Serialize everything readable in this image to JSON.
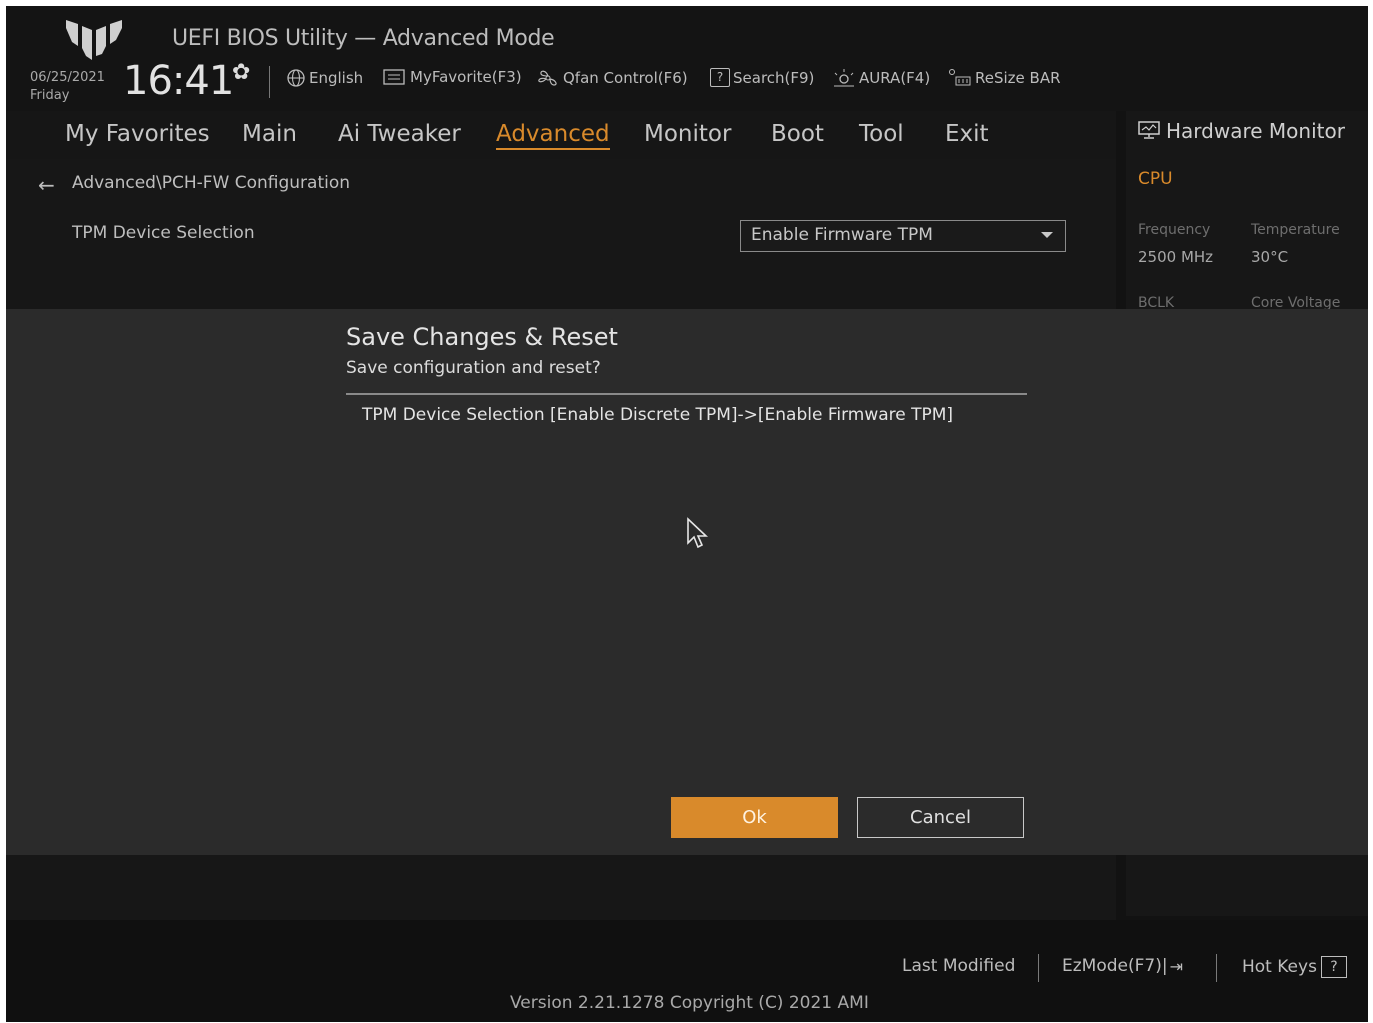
{
  "header": {
    "title": "UEFI BIOS Utility — Advanced Mode",
    "date": "06/25/2021",
    "day": "Friday",
    "time": "16:41",
    "tools": [
      {
        "label": "English",
        "icon": "globe-icon"
      },
      {
        "label": "MyFavorite(F3)",
        "icon": "favorite-icon"
      },
      {
        "label": "Qfan Control(F6)",
        "icon": "fan-icon"
      },
      {
        "label": "Search(F9)",
        "icon": "search-icon",
        "glyph": "?"
      },
      {
        "label": "AURA(F4)",
        "icon": "aura-icon"
      },
      {
        "label": "ReSize BAR",
        "icon": "resize-bar-icon"
      }
    ]
  },
  "menu": {
    "items": [
      "My Favorites",
      "Main",
      "Ai Tweaker",
      "Advanced",
      "Monitor",
      "Boot",
      "Tool",
      "Exit"
    ],
    "active": "Advanced"
  },
  "content": {
    "breadcrumb": "Advanced\\PCH-FW Configuration",
    "tpm_label": "TPM Device Selection",
    "tpm_value": "Enable Firmware TPM"
  },
  "hardware_monitor": {
    "title": "Hardware Monitor",
    "section": "CPU",
    "frequency_label": "Frequency",
    "frequency_value": "2500 MHz",
    "temperature_label": "Temperature",
    "temperature_value": "30°C",
    "bclk_label": "BCLK",
    "core_voltage_label": "Core Voltage"
  },
  "dialog": {
    "title": "Save Changes & Reset",
    "subtitle": "Save configuration and reset?",
    "change": "TPM Device Selection [Enable Discrete TPM]->[Enable Firmware TPM]",
    "ok_label": "Ok",
    "cancel_label": "Cancel"
  },
  "footer": {
    "last_modified": "Last Modified",
    "ezmode": "EzMode(F7)|",
    "hotkeys": "Hot Keys",
    "hotkeys_glyph": "?",
    "version": "Version 2.21.1278 Copyright (C) 2021 AMI"
  },
  "colors": {
    "accent": "#d98a2b",
    "background": "#121212",
    "dialog": "#2b2b2b"
  }
}
